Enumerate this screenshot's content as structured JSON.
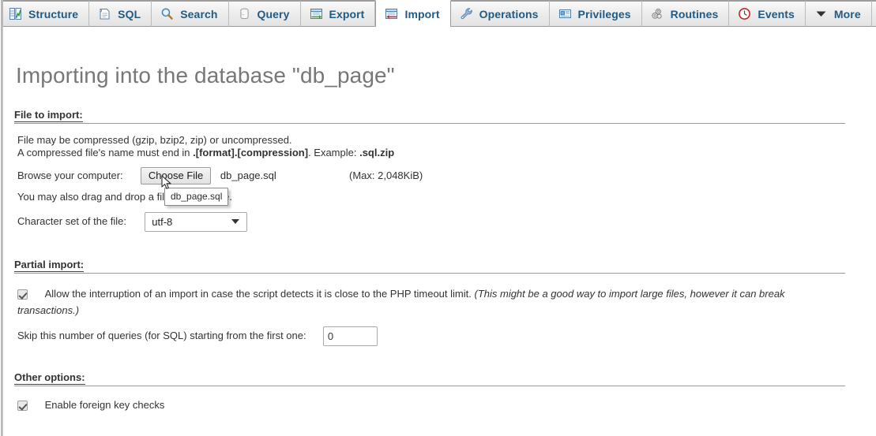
{
  "tabs": [
    {
      "label": "Structure",
      "icon": "structure-icon",
      "active": false
    },
    {
      "label": "SQL",
      "icon": "sql-icon",
      "active": false
    },
    {
      "label": "Search",
      "icon": "search-icon",
      "active": false
    },
    {
      "label": "Query",
      "icon": "query-icon",
      "active": false
    },
    {
      "label": "Export",
      "icon": "export-icon",
      "active": false
    },
    {
      "label": "Import",
      "icon": "import-icon",
      "active": true
    },
    {
      "label": "Operations",
      "icon": "wrench-icon",
      "active": false
    },
    {
      "label": "Privileges",
      "icon": "privileges-icon",
      "active": false
    },
    {
      "label": "Routines",
      "icon": "routines-icon",
      "active": false
    },
    {
      "label": "Events",
      "icon": "clock-icon",
      "active": false
    },
    {
      "label": "More",
      "icon": "chevron-down-icon",
      "active": false
    }
  ],
  "page": {
    "title": "Importing into the database \"db_page\""
  },
  "file_section": {
    "legend": "File to import:",
    "hint_line1": "File may be compressed (gzip, bzip2, zip) or uncompressed.",
    "hint_line2_a": "A compressed file's name must end in ",
    "hint_line2_b": ".[format].[compression]",
    "hint_line2_c": ". Example: ",
    "hint_line2_d": ".sql.zip",
    "browse_label": "Browse your computer:",
    "choose_file_button": "Choose File",
    "chosen_file_name": "db_page.sql",
    "max_size": "(Max: 2,048KiB)",
    "dragdrop_text": "You may also drag and drop a file on any page.",
    "charset_label": "Character set of the file:",
    "charset_value": "utf-8",
    "charset_options": [
      "utf-8"
    ],
    "tooltip_text": "db_page.sql"
  },
  "partial_import": {
    "legend": "Partial import:",
    "allow_interrupt_label": "Allow the interruption of an import in case the script detects it is close to the PHP timeout limit.",
    "allow_interrupt_note": "(This might be a good way to import large files, however it can break transactions.)",
    "allow_interrupt_checked": true,
    "skip_label": "Skip this number of queries (for SQL) starting from the first one:",
    "skip_value": "0"
  },
  "other_options": {
    "legend": "Other options:",
    "foreign_key_label": "Enable foreign key checks",
    "foreign_key_checked": true
  },
  "colors": {
    "tab_text": "#235a81",
    "title_text": "#777777",
    "body_text": "#333333",
    "rule": "#999999",
    "tabbar_bg": "#ececec"
  }
}
